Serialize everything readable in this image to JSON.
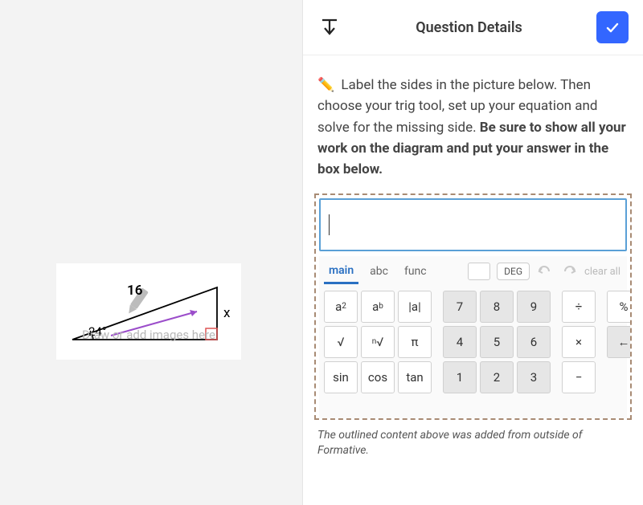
{
  "header": {
    "title": "Question Details"
  },
  "question": {
    "pencil_emoji": "✏️",
    "line1": " Label the sides in the picture below. Then choose your trig tool, set up your equation and solve for the missing side. ",
    "line2_bold": "Be sure to show all your work on the diagram and put your answer in the box below."
  },
  "diagram": {
    "hypotenuse_label": "16",
    "angle_label": "24°",
    "opposite_label": "x",
    "placeholder": "Draw or add images here"
  },
  "calculator": {
    "tabs": {
      "main": "main",
      "abc": "abc",
      "func": "func"
    },
    "deg": "DEG",
    "clear_all": "clear all",
    "keys": {
      "a2": "a",
      "a2_sup": "2",
      "ab": "a",
      "ab_sup": "b",
      "abs_open": "|",
      "abs_a": "a",
      "abs_close": "|",
      "k7": "7",
      "k8": "8",
      "k9": "9",
      "div": "÷",
      "pct": "%",
      "sqrt": "√",
      "nroot": "√",
      "nroot_sup": "n",
      "pi": "π",
      "k4": "4",
      "k5": "5",
      "k6": "6",
      "times": "×",
      "back": "←",
      "sin": "sin",
      "cos": "cos",
      "tan": "tan",
      "k1": "1",
      "k2": "2",
      "k3": "3",
      "minus": "−"
    }
  },
  "footnote": "The outlined content above was added from outside of Formative."
}
